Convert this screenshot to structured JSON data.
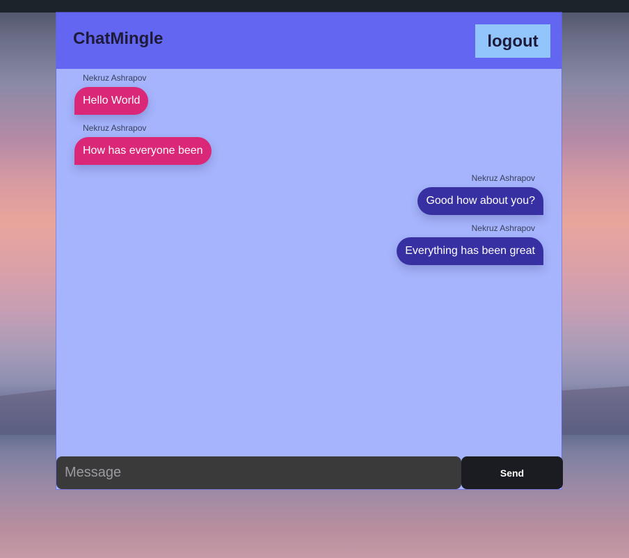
{
  "app": {
    "title": "ChatMingle",
    "logout_label": "logout"
  },
  "colors": {
    "header_bg": "#6366f1",
    "chat_bg": "#a5b4fc",
    "incoming_bubble": "#db2777",
    "outgoing_bubble": "#3730a3",
    "logout_bg": "#93c5fd",
    "send_bg": "#1a1c21",
    "input_bg": "#3a3a3a"
  },
  "messages": [
    {
      "sender": "Nekruz Ashrapov",
      "text": "Hello World",
      "side": "left"
    },
    {
      "sender": "Nekruz Ashrapov",
      "text": "How has everyone been",
      "side": "left"
    },
    {
      "sender": "Nekruz Ashrapov",
      "text": "Good how about you?",
      "side": "right"
    },
    {
      "sender": "Nekruz Ashrapov",
      "text": "Everything has been great",
      "side": "right"
    }
  ],
  "composer": {
    "placeholder": "Message",
    "value": "",
    "send_label": "Send"
  }
}
